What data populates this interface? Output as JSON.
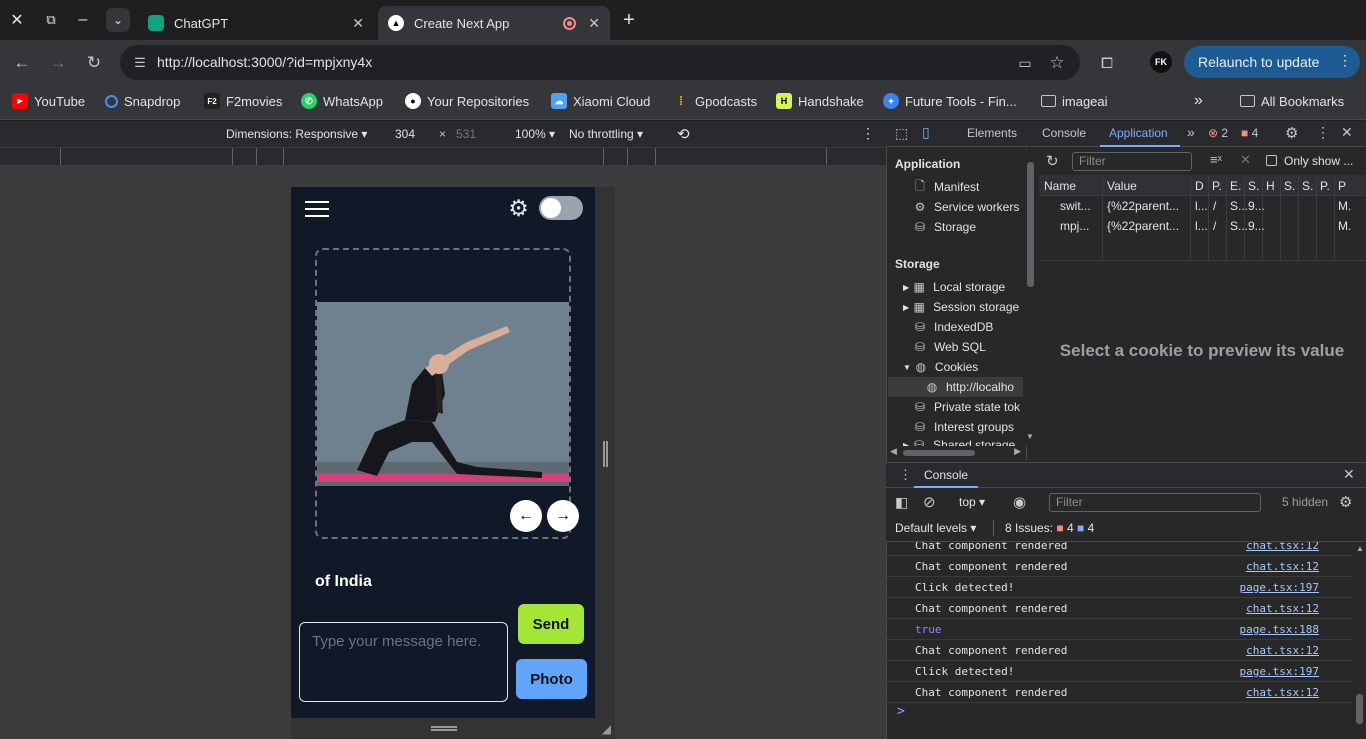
{
  "browser": {
    "tabs": [
      {
        "title": "ChatGPT",
        "active": false
      },
      {
        "title": "Create Next App",
        "active": true
      }
    ],
    "url": "http://localhost:3000/?id=mpjxny4x",
    "relaunch_label": "Relaunch to update",
    "profile_initials": "FK"
  },
  "bookmarks": {
    "items": [
      "YouTube",
      "Snapdrop",
      "F2movies",
      "WhatsApp",
      "Your Repositories",
      "Xiaomi Cloud",
      "Gpodcasts",
      "Handshake",
      "Future Tools - Fin...",
      "imageai"
    ],
    "all_label": "All Bookmarks"
  },
  "device_toolbar": {
    "dimensions": "Dimensions: Responsive",
    "width": "304",
    "times": "×",
    "height": "531",
    "zoom": "100%",
    "throttling": "No throttling"
  },
  "devtools": {
    "tabs": [
      "Elements",
      "Console",
      "Application"
    ],
    "active_tab": "Application",
    "errors": "2",
    "warnings": "4",
    "filter_placeholder": "Filter",
    "only_show": "Only show ...",
    "application_header": "Application",
    "application_items": [
      "Manifest",
      "Service workers",
      "Storage"
    ],
    "storage_header": "Storage",
    "storage_items": [
      "Local storage",
      "Session storage",
      "IndexedDB",
      "Web SQL",
      "Cookies"
    ],
    "cookie_origin": "http://localho",
    "extra_items": [
      "Private state tok",
      "Interest groups",
      "Shared storage"
    ],
    "table_headers": [
      "Name",
      "Value",
      "D",
      "P.",
      "E.",
      "S.",
      "H",
      "S.",
      "S.",
      "P.",
      "P"
    ],
    "rows": [
      {
        "name": "swit...",
        "value": "{%22parent...",
        "d": "l...",
        "p": "/",
        "e": "S...",
        "s": "9...",
        "last": "M."
      },
      {
        "name": "mpj...",
        "value": "{%22parent...",
        "d": "l...",
        "p": "/",
        "e": "S...",
        "s": "9...",
        "last": "M."
      }
    ],
    "preview_text": "Select a cookie to preview its value"
  },
  "console": {
    "tab": "Console",
    "context": "top",
    "filter_placeholder": "Filter",
    "hidden": "5 hidden",
    "levels": "Default levels",
    "issues_label": "8 Issues:",
    "issues_errors": "4",
    "issues_info": "4",
    "logs": [
      {
        "msg": "Chat component rendered",
        "src": "chat.tsx:12"
      },
      {
        "msg": "Chat component rendered",
        "src": "chat.tsx:12"
      },
      {
        "msg": "Click detected!",
        "src": "page.tsx:197"
      },
      {
        "msg": "Chat component rendered",
        "src": "chat.tsx:12"
      },
      {
        "msg": "true",
        "src": "page.tsx:188"
      },
      {
        "msg": "Chat component rendered",
        "src": "chat.tsx:12"
      },
      {
        "msg": "Click detected!",
        "src": "page.tsx:197"
      },
      {
        "msg": "Chat component rendered",
        "src": "chat.tsx:12"
      }
    ],
    "prompt": ">"
  },
  "app": {
    "caption": "of India",
    "message_placeholder": "Type your message here.",
    "send_label": "Send",
    "photo_label": "Photo",
    "prev_icon": "arrow-left-icon",
    "next_icon": "arrow-right-icon"
  },
  "colors": {
    "app_bg": "#111827",
    "send_bg": "#a3e635",
    "photo_bg": "#60a5fa",
    "relaunch_bg": "#1e5a94"
  }
}
